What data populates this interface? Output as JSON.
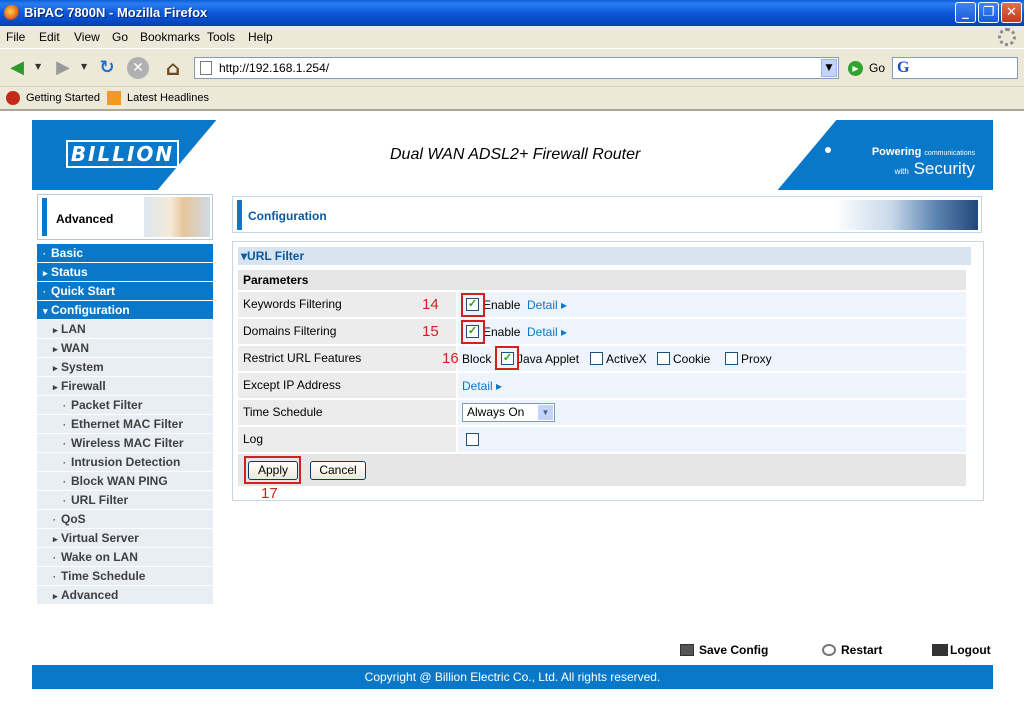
{
  "window": {
    "title": "BiPAC 7800N - Mozilla Firefox"
  },
  "menubar": {
    "items": [
      "File",
      "Edit",
      "View",
      "Go",
      "Bookmarks",
      "Tools",
      "Help"
    ]
  },
  "navbar": {
    "url": "http://192.168.1.254/",
    "go_label": "Go",
    "search_engine_glyph": "G"
  },
  "bookmarks": {
    "items": [
      "Getting Started",
      "Latest Headlines"
    ]
  },
  "banner": {
    "logo": "BILLION",
    "headline": "Dual WAN ADSL2+ Firewall Router",
    "powering": "Powering",
    "powering_small": "communications",
    "with": "with",
    "security": "Security"
  },
  "sidebar": {
    "advanced_label": "Advanced",
    "items": [
      {
        "label": "Basic",
        "level": "top",
        "marker": "·"
      },
      {
        "label": "Status",
        "level": "top",
        "marker": "▸"
      },
      {
        "label": "Quick Start",
        "level": "top",
        "marker": "·"
      },
      {
        "label": "Configuration",
        "level": "top",
        "marker": "▾"
      },
      {
        "label": "LAN",
        "level": "sub",
        "marker": "▸"
      },
      {
        "label": "WAN",
        "level": "sub",
        "marker": "▸"
      },
      {
        "label": "System",
        "level": "sub",
        "marker": "▸"
      },
      {
        "label": "Firewall",
        "level": "sub",
        "marker": "▸"
      },
      {
        "label": "Packet Filter",
        "level": "subsub",
        "marker": "·"
      },
      {
        "label": "Ethernet MAC Filter",
        "level": "subsub",
        "marker": "·"
      },
      {
        "label": "Wireless MAC Filter",
        "level": "subsub",
        "marker": "·"
      },
      {
        "label": "Intrusion Detection",
        "level": "subsub",
        "marker": "·"
      },
      {
        "label": "Block WAN PING",
        "level": "subsub",
        "marker": "·"
      },
      {
        "label": "URL Filter",
        "level": "subsub",
        "marker": "·"
      },
      {
        "label": "QoS",
        "level": "sub",
        "marker": "·"
      },
      {
        "label": "Virtual Server",
        "level": "sub",
        "marker": "▸"
      },
      {
        "label": "Wake on LAN",
        "level": "sub",
        "marker": "·"
      },
      {
        "label": "Time Schedule",
        "level": "sub",
        "marker": "·"
      },
      {
        "label": "Advanced",
        "level": "sub",
        "marker": "▸"
      }
    ]
  },
  "main": {
    "section_title": "Configuration",
    "panel_title": "URL Filter",
    "params_title": "Parameters",
    "rows": {
      "keywords": {
        "label": "Keywords Filtering",
        "checked": true,
        "option": "Enable",
        "detail": "Detail"
      },
      "domains": {
        "label": "Domains Filtering",
        "checked": true,
        "option": "Enable",
        "detail": "Detail"
      },
      "restrict": {
        "label": "Restrict URL Features",
        "prefix": "Block",
        "java": "Java Applet",
        "activex": "ActiveX",
        "cookie": "Cookie",
        "proxy": "Proxy"
      },
      "except": {
        "label": "Except IP Address",
        "detail": "Detail"
      },
      "schedule": {
        "label": "Time Schedule",
        "value": "Always On"
      },
      "log": {
        "label": "Log"
      }
    },
    "apply_label": "Apply",
    "cancel_label": "Cancel",
    "annotations": [
      "14",
      "15",
      "16",
      "17"
    ]
  },
  "footer": {
    "save": "Save Config",
    "restart": "Restart",
    "logout": "Logout",
    "copyright": "Copyright @ Billion Electric Co., Ltd. All rights reserved."
  },
  "colors": {
    "brand_blue": "#0a78c8",
    "annotation_red": "#d02020",
    "link_blue": "#0a78c8"
  }
}
